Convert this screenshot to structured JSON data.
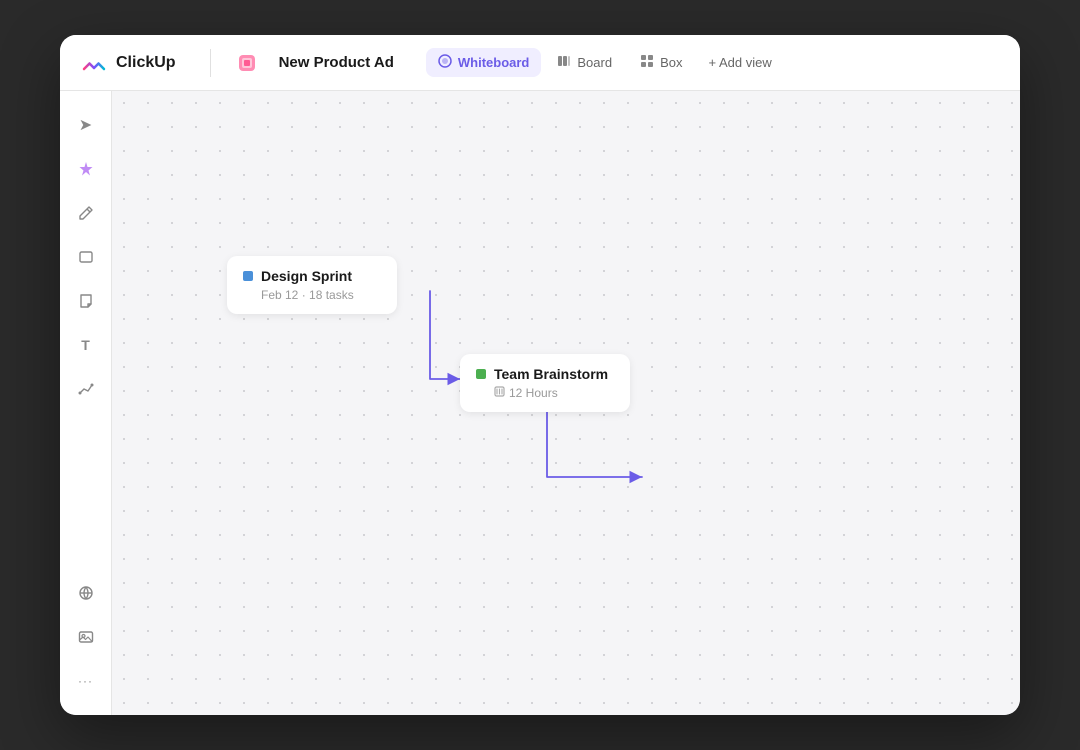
{
  "app": {
    "logo_text": "ClickUp"
  },
  "header": {
    "project_title": "New Product Ad",
    "tabs": [
      {
        "id": "whiteboard",
        "label": "Whiteboard",
        "icon": "⬡",
        "active": true
      },
      {
        "id": "board",
        "label": "Board",
        "icon": "▤",
        "active": false
      },
      {
        "id": "box",
        "label": "Box",
        "icon": "⊞",
        "active": false
      }
    ],
    "add_view_label": "+ Add view"
  },
  "toolbar": {
    "tools": [
      {
        "id": "cursor",
        "icon": "➤",
        "label": "cursor-tool"
      },
      {
        "id": "ai",
        "icon": "✦",
        "label": "ai-tool"
      },
      {
        "id": "pen",
        "icon": "✏",
        "label": "pen-tool"
      },
      {
        "id": "rect",
        "icon": "▢",
        "label": "rectangle-tool"
      },
      {
        "id": "note",
        "icon": "◳",
        "label": "note-tool"
      },
      {
        "id": "text",
        "icon": "T",
        "label": "text-tool"
      },
      {
        "id": "connect",
        "icon": "↯",
        "label": "connect-tool"
      },
      {
        "id": "globe",
        "icon": "⊕",
        "label": "embed-tool"
      },
      {
        "id": "image",
        "icon": "⊡",
        "label": "image-tool"
      },
      {
        "id": "more",
        "icon": "···",
        "label": "more-tool"
      }
    ]
  },
  "canvas": {
    "card1": {
      "title": "Design Sprint",
      "dot_color": "#4a90d9",
      "meta": "Feb 12  ·  18 tasks"
    },
    "card2": {
      "title": "Team Brainstorm",
      "dot_color": "#4caf50",
      "sub_icon": "⏱",
      "sub_text": "12 Hours"
    }
  }
}
